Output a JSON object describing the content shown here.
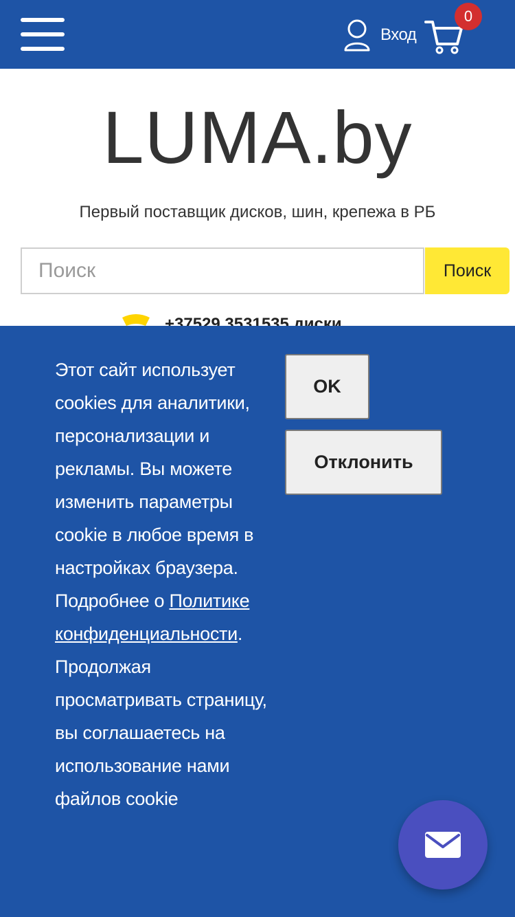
{
  "header": {
    "login_label": "Вход",
    "cart_count": "0",
    "menu_icon": "hamburger-icon",
    "user_icon": "user-icon",
    "cart_icon": "cart-icon"
  },
  "brand": {
    "logo_text": "LUMA.by",
    "tagline": "Первый поставщик дисков, шин, крепежа в РБ"
  },
  "search": {
    "placeholder": "Поиск",
    "button_label": "Поиск"
  },
  "contact": {
    "phone_text": "+37529 3531535 диски"
  },
  "cookie_banner": {
    "text_before_link": "Этот сайт использует cookies для аналитики, персонализации и рекламы. Вы можете изменить параметры cookie в любое время в настройках браузера. Подробнее о ",
    "link_text": "Политике конфиденциальности",
    "text_after_link": ". Продолжая просматривать страницу, вы соглашаетесь на использование нами файлов cookie",
    "ok_label": "OK",
    "decline_label": "Отклонить"
  },
  "fab": {
    "icon": "mail-icon"
  },
  "colors": {
    "header_bg": "#1e54a6",
    "banner_bg": "#1e54a6",
    "search_button": "#ffe835",
    "badge": "#d32f2f",
    "fab": "#4a4fbf"
  }
}
